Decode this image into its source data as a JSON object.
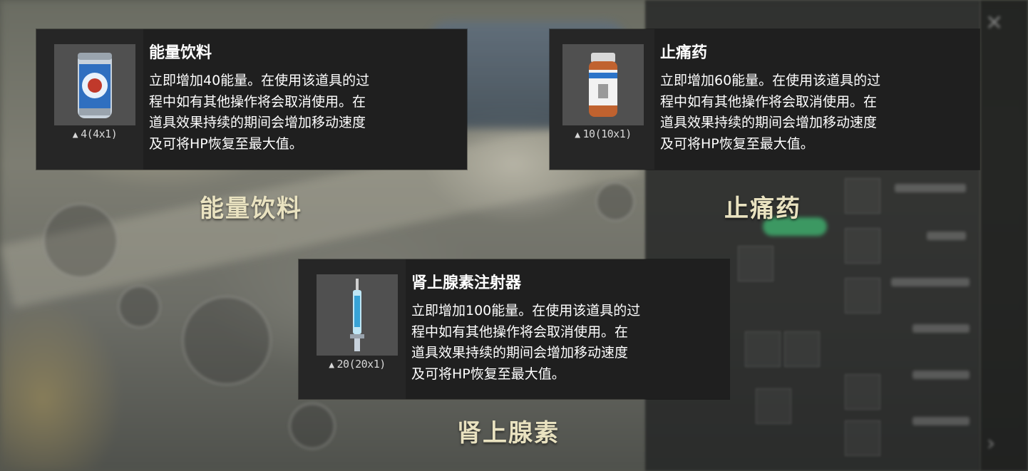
{
  "cards": [
    {
      "title": "能量饮料",
      "description": "立即增加40能量。在使用该道具的过\n程中如有其他操作将会取消使用。在\n道具效果持续的期间会增加移动速度\n及可将HP恢复至最大值。",
      "weight": "4(4x1)",
      "icon": "energy-drink-can-icon",
      "caption": "能量饮料"
    },
    {
      "title": "止痛药",
      "description": "立即增加60能量。在使用该道具的过\n程中如有其他操作将会取消使用。在\n道具效果持续的期间会增加移动速度\n及可将HP恢复至最大值。",
      "weight": "10(10x1)",
      "icon": "painkiller-bottle-icon",
      "caption": "止痛药"
    },
    {
      "title": "肾上腺素注射器",
      "description": "立即增加100能量。在使用该道具的过\n程中如有其他操作将会取消使用。在\n道具效果持续的期间会增加移动速度\n及可将HP恢复至最大值。",
      "weight": "20(20x1)",
      "icon": "adrenaline-syringe-icon",
      "caption": "肾上腺素"
    }
  ],
  "colors": {
    "card_bg": "#1f1f1f",
    "caption": "#e9e2c0",
    "text": "#ffffff"
  }
}
